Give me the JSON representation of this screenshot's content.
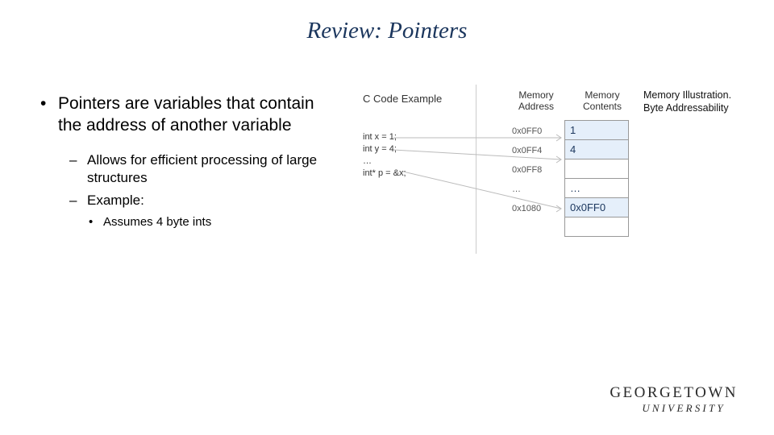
{
  "title": "Review: Pointers",
  "bullets": {
    "main": "Pointers are variables that contain the address of another variable",
    "sub1": "Allows for efficient processing of large structures",
    "sub2": "Example:",
    "subsub": "Assumes 4 byte ints"
  },
  "diagram": {
    "code_label": "C Code Example",
    "code_line1": "int x = 1;",
    "code_line2": "int y = 4;",
    "code_line3": "…",
    "code_line4": "int* p = &x;",
    "mem_addr_label": "Memory Address",
    "mem_cont_label": "Memory Contents",
    "illus_label_l1": "Memory Illustration.",
    "illus_label_l2": "Byte Addressability",
    "addrs": {
      "r0": "0x0FF0",
      "r1": "0x0FF4",
      "r2": "0x0FF8",
      "r3": "…",
      "r4": "0x1080"
    },
    "cells": {
      "r0": "1",
      "r1": "4",
      "r2": "",
      "r3": "…",
      "r4": "0x0FF0",
      "r5": ""
    }
  },
  "logo": {
    "line1": "GEORGETOWN",
    "line2": "UNIVERSITY"
  }
}
